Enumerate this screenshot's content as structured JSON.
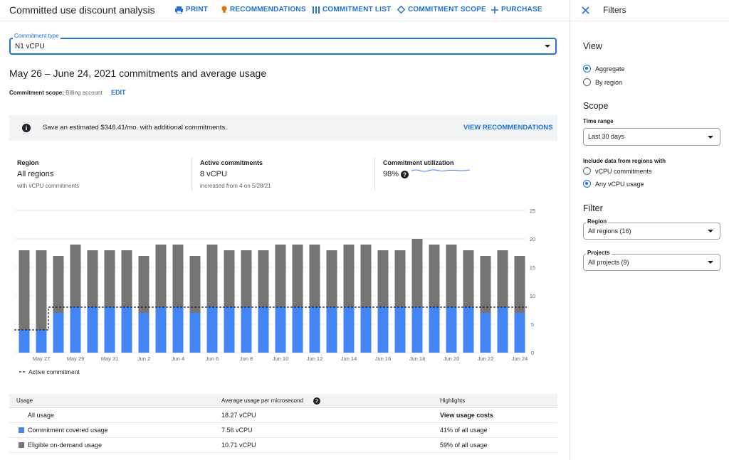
{
  "header": {
    "title": "Committed use discount analysis",
    "buttons": {
      "print": "PRINT",
      "recommendations": "RECOMMENDATIONS",
      "commitment_list": "COMMITMENT LIST",
      "commitment_scope": "COMMITMENT SCOPE",
      "purchase": "PURCHASE"
    }
  },
  "commitment_type": {
    "label": "Commitment type",
    "value": "N1 vCPU"
  },
  "summary": {
    "heading": "May 26 – June 24, 2021 commitments and average usage",
    "scope_label": "Commitment scope:",
    "scope_value": "Billing account",
    "edit": "EDIT"
  },
  "banner": {
    "text": "Save an estimated $346.41/mo. with additional commitments.",
    "action": "VIEW RECOMMENDATIONS"
  },
  "metrics": {
    "region": {
      "label": "Region",
      "value": "All regions",
      "sub": "with vCPU commitments"
    },
    "active": {
      "label": "Active commitments",
      "value": "8 vCPU",
      "sub": "increased from 4 on 5/28/21"
    },
    "utilization": {
      "label": "Commitment utilization",
      "value": "98%"
    }
  },
  "chart_legend": "Active commitment",
  "chart_data": {
    "type": "bar",
    "categories": [
      "May 26",
      "May 27",
      "May 28",
      "May 29",
      "May 30",
      "May 31",
      "Jun 1",
      "Jun 2",
      "Jun 3",
      "Jun 4",
      "Jun 5",
      "Jun 6",
      "Jun 7",
      "Jun 8",
      "Jun 9",
      "Jun 10",
      "Jun 11",
      "Jun 12",
      "Jun 13",
      "Jun 14",
      "Jun 15",
      "Jun 16",
      "Jun 17",
      "Jun 18",
      "Jun 19",
      "Jun 20",
      "Jun 21",
      "Jun 22",
      "Jun 23",
      "Jun 24"
    ],
    "x_tick_labels": [
      "May 27",
      "May 29",
      "May 31",
      "Jun 2",
      "Jun 4",
      "Jun 6",
      "Jun 8",
      "Jun 10",
      "Jun 12",
      "Jun 14",
      "Jun 16",
      "Jun 18",
      "Jun 20",
      "Jun 22",
      "Jun 24"
    ],
    "series": [
      {
        "name": "Commitment covered usage",
        "color": "#4285f4",
        "values": [
          4,
          4,
          7,
          8,
          8,
          8,
          8,
          7,
          8,
          8,
          7,
          8,
          8,
          8,
          8,
          8,
          8,
          8,
          8,
          8,
          8,
          8,
          8,
          8,
          8,
          8,
          8,
          7,
          8,
          7
        ]
      },
      {
        "name": "Eligible on-demand usage",
        "color": "#757575",
        "values": [
          14,
          14,
          10,
          11,
          10,
          10,
          10,
          10,
          11,
          11,
          10,
          11,
          10,
          10,
          10,
          11,
          11,
          11,
          10,
          11,
          11,
          10,
          10,
          12,
          11,
          11,
          10,
          10,
          10,
          10
        ]
      }
    ],
    "active_commitment": [
      4,
      4,
      8,
      8,
      8,
      8,
      8,
      8,
      8,
      8,
      8,
      8,
      8,
      8,
      8,
      8,
      8,
      8,
      8,
      8,
      8,
      8,
      8,
      8,
      8,
      8,
      8,
      8,
      8,
      8
    ],
    "y_ticks": [
      0,
      5,
      10,
      15,
      20,
      25
    ],
    "ylim": [
      0,
      25
    ],
    "stacked": true,
    "grid": true
  },
  "usage_table": {
    "headers": [
      "Usage",
      "Average usage per microsecond",
      "Highlights"
    ],
    "rows": [
      {
        "name": "All usage",
        "avg": "18.27 vCPU",
        "highlight": "View usage costs"
      },
      {
        "name": "Commitment covered usage",
        "avg": "7.56 vCPU",
        "highlight": "41% of all usage",
        "color": "#4285f4"
      },
      {
        "name": "Eligible on-demand usage",
        "avg": "10.71 vCPU",
        "highlight": "59% of all usage",
        "color": "#757575"
      }
    ]
  },
  "filters": {
    "title": "Filters",
    "view": {
      "heading": "View",
      "options": [
        "Aggregate",
        "By region"
      ],
      "selected": "Aggregate"
    },
    "scope": {
      "heading": "Scope",
      "time_range_label": "Time range",
      "time_range_value": "Last 30 days",
      "include_label": "Include data from regions with",
      "include_options": [
        "vCPU commitments",
        "Any vCPU usage"
      ],
      "include_selected": "Any vCPU usage"
    },
    "filter": {
      "heading": "Filter",
      "region_label": "Region",
      "region_value": "All regions (16)",
      "projects_label": "Projects",
      "projects_value": "All projects (9)"
    }
  },
  "colors": {
    "accent": "#1a73e8",
    "covered": "#4285f4",
    "ondemand": "#757575"
  }
}
